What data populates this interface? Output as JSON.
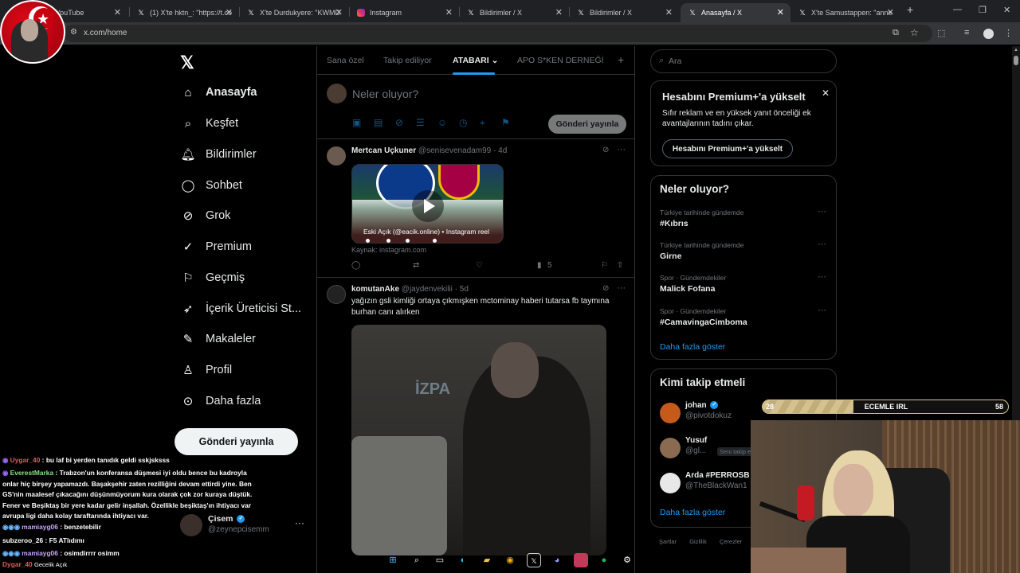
{
  "browser": {
    "tabs": [
      {
        "title": "YouTube",
        "icon": "youtube-icon"
      },
      {
        "title": "(1) X'te hktn_: \"https://t.co",
        "icon": "x-icon"
      },
      {
        "title": "X'te Durdukyere: \"KWMD",
        "icon": "x-icon"
      },
      {
        "title": "Instagram",
        "icon": "instagram-icon"
      },
      {
        "title": "Bildirimler / X",
        "icon": "x-icon"
      },
      {
        "title": "Bildirimler / X",
        "icon": "x-icon"
      },
      {
        "title": "Anasayfa / X",
        "icon": "x-icon",
        "active": true
      },
      {
        "title": "X'te Samustappen: \"anne",
        "icon": "x-icon"
      }
    ],
    "url": "x.com/home"
  },
  "nav": {
    "items": [
      {
        "label": "Anasayfa",
        "icon": "home-icon"
      },
      {
        "label": "Keşfet",
        "icon": "search-icon"
      },
      {
        "label": "Bildirimler",
        "icon": "bell-icon"
      },
      {
        "label": "Sohbet",
        "icon": "chat-icon"
      },
      {
        "label": "Grok",
        "icon": "grok-icon"
      },
      {
        "label": "Premium",
        "icon": "premium-icon"
      },
      {
        "label": "Geçmiş",
        "icon": "bookmark-icon"
      },
      {
        "label": "İçerik Üreticisi St...",
        "icon": "rocket-icon"
      },
      {
        "label": "Makaleler",
        "icon": "article-icon"
      },
      {
        "label": "Profil",
        "icon": "profile-icon"
      },
      {
        "label": "Daha fazla",
        "icon": "more-icon"
      }
    ],
    "post_button": "Gönderi yayınla",
    "account": {
      "name": "Çisem",
      "handle": "@zeynepcisemm"
    }
  },
  "timeline": {
    "tabs": [
      "Sana özel",
      "Takip ediliyor",
      "ATABARI",
      "APO S*KEN DERNEĞİ"
    ],
    "compose_placeholder": "Neler oluyor?",
    "compose_button": "Gönderi yayınla",
    "tweets": [
      {
        "name": "Mertcan Uçkuner",
        "handle": "@senisevenadam99",
        "time": "4d",
        "media_caption": "Eski Açık (@eacik.online) • Instagram reel",
        "source": "Kaynak: instagram.com",
        "views": "5"
      },
      {
        "name": "komutanAke",
        "handle": "@jaydenvekilii",
        "time": "5d",
        "text": "yağızın gsli kimliği ortaya çıkmışken mctominay haberi tutarsa fb taymına burhan canı alırken",
        "media_sign": "İZPA"
      }
    ]
  },
  "sidebar": {
    "search_placeholder": "Ara",
    "premium": {
      "title": "Hesabını Premium+'a yükselt",
      "desc": "Sıfır reklam ve en yüksek yanıt önceliği ek avantajlarının tadını çıkar.",
      "button": "Hesabını Premium+'a yükselt"
    },
    "trends": {
      "title": "Neler oluyor?",
      "items": [
        {
          "context": "Türkiye tarihinde gündemde",
          "name": "#Kıbrıs"
        },
        {
          "context": "Türkiye tarihinde gündemde",
          "name": "Girne"
        },
        {
          "context": "Spor · Gündemdekiler",
          "name": "Malick Fofana"
        },
        {
          "context": "Spor · Gündemdekiler",
          "name": "#CamavingaCimboma"
        }
      ],
      "show_more": "Daha fazla göster"
    },
    "who_to_follow": {
      "title": "Kimi takip etmeli",
      "items": [
        {
          "name": "johan",
          "handle": "@pivotdokuz",
          "verified": true
        },
        {
          "name": "Yusuf",
          "handle": "@gl...",
          "badge": "Seni takip ediy"
        },
        {
          "name": "Arda #PERROSB",
          "handle": "@TheBlackWan1"
        }
      ],
      "show_more": "Daha fazla göster"
    },
    "footer": [
      "Şartlar",
      "Gizlilik",
      "Çerezler"
    ]
  },
  "stream": {
    "goal": {
      "start": "28",
      "label": "ECEMLE IRL",
      "end": "58",
      "progress": 0.37
    },
    "chat": [
      {
        "user": "Uygar_40",
        "color": "#e05a5a",
        "text": "bu laf bi yerden tanıdık geldi sskjsksss"
      },
      {
        "user": "EverestMarka",
        "color": "#8be08b",
        "text": "Trabzon'un konferansa düşmesi iyi oldu bence bu kadroyla onlar hiç birşey yapamazdı. Başakşehir zaten rezilliğini devam ettirdi yine. Ben GS'nin maalesef çıkacağını düşünmüyorum kura olarak çok zor kuraya düştük. Fener ve Beşiktaş bir yere kadar gelir inşallah. Özellikle beşiktaş'ın ihtiyacı var avrupa ligi daha kolay taraftarında ihtiyacı var."
      },
      {
        "user": "mamiayg06",
        "color": "#c7a6ff",
        "text": "benzetebilir"
      },
      {
        "user": "subzeroo_26",
        "color": "#ffffff",
        "text": "F5 ATlıdımı"
      },
      {
        "user": "mamiayg06",
        "color": "#c7a6ff",
        "text": "osimdirrrr osimm"
      },
      {
        "user": "Dygar_40",
        "color": "#e05a5a",
        "text": "Gecelik Açık"
      }
    ]
  }
}
